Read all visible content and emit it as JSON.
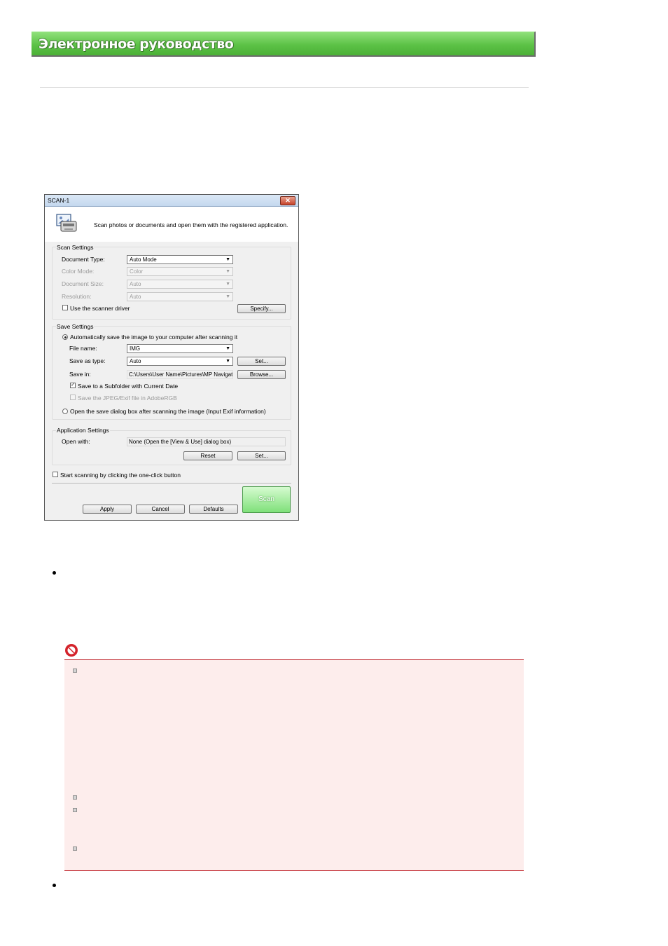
{
  "header": {
    "title": "Электронное руководство"
  },
  "dialog": {
    "title": "SCAN-1",
    "description": "Scan photos or documents and open them with the registered application.",
    "scan_settings": {
      "title": "Scan Settings",
      "document_type_label": "Document Type:",
      "document_type_value": "Auto Mode",
      "color_mode_label": "Color Mode:",
      "color_mode_value": "Color",
      "document_size_label": "Document Size:",
      "document_size_value": "Auto",
      "resolution_label": "Resolution:",
      "resolution_value": "Auto",
      "use_driver_label": "Use the scanner driver",
      "specify_button": "Specify..."
    },
    "save_settings": {
      "title": "Save Settings",
      "auto_save_label": "Automatically save the image to your computer after scanning it",
      "file_name_label": "File name:",
      "file_name_value": "IMG",
      "save_as_type_label": "Save as type:",
      "save_as_type_value": "Auto",
      "set_button": "Set...",
      "save_in_label": "Save in:",
      "save_in_value": "C:\\Users\\User Name\\Pictures\\MP Navigat",
      "browse_button": "Browse...",
      "subfolder_label": "Save to a Subfolder with Current Date",
      "adobergb_label": "Save the JPEG/Exif file in AdobeRGB",
      "open_dialog_label": "Open the save dialog box after scanning the image (Input Exif information)"
    },
    "application_settings": {
      "title": "Application Settings",
      "open_with_label": "Open with:",
      "open_with_value": "None (Open the [View & Use] dialog box)",
      "reset_button": "Reset",
      "set_button": "Set..."
    },
    "one_click_label": "Start scanning by clicking the one-click button",
    "apply_button": "Apply",
    "cancel_button": "Cancel",
    "defaults_button": "Defaults",
    "scan_button": "Scan",
    "close_glyph": "✕"
  },
  "icons": {
    "note": "prohibition-icon",
    "app": "scanner-photo-icon"
  },
  "colors": {
    "banner": "#5cc246",
    "note_bg": "#fdedec",
    "note_border": "#c0262d",
    "scan_button": "#7fe07a"
  }
}
